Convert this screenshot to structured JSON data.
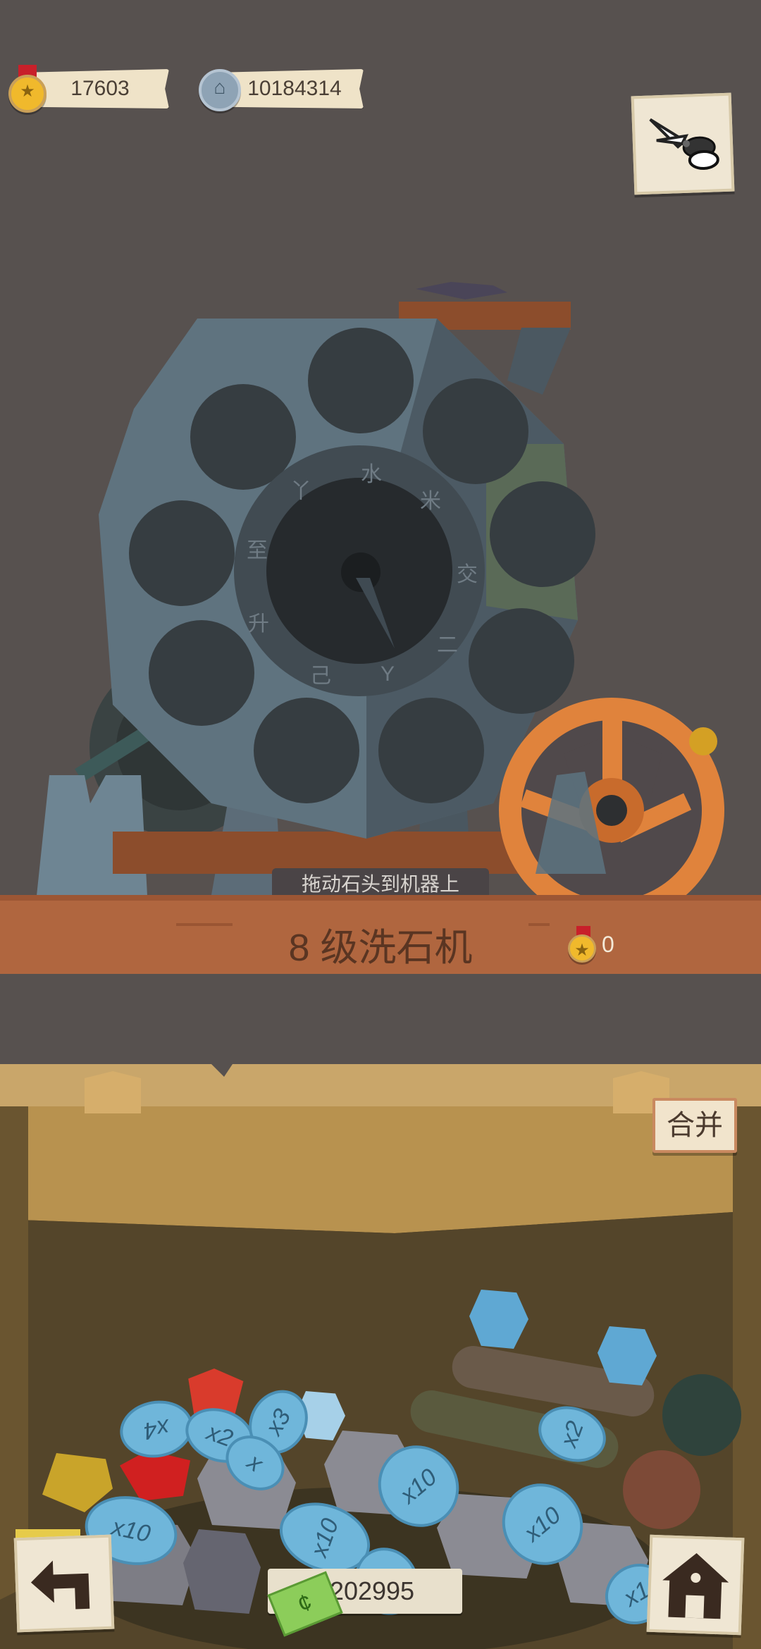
{
  "currency": {
    "medals": "17603",
    "gears": "10184314"
  },
  "machine": {
    "hint": "拖动石头到机器上",
    "level_label": "8 级洗石机",
    "reward_count": "0"
  },
  "bin": {
    "merge_label": "合并",
    "money": "5202995"
  },
  "stones": {
    "t1": "x4",
    "t2": "x2",
    "t3": "x3",
    "t4": "x",
    "t5": "x10",
    "t6": "x10",
    "t7": "x10",
    "t8": "x10",
    "t9": "x2",
    "t10": "x1",
    "t11": "x1",
    "t12": "x10"
  },
  "dial_marks": [
    "水",
    "米",
    "交",
    "二",
    "Y",
    "己",
    "升",
    "至",
    "丫"
  ],
  "colors": {
    "background": "#57514f",
    "wood": "#b0663f",
    "wheel": "#e0833c",
    "tag": "#6fb6da"
  },
  "icons": {
    "medal": "medal-icon",
    "gear": "gear-coin-icon",
    "tool": "pliers-icon",
    "back": "back-arrow-icon",
    "home": "home-icon",
    "money": "banknote-icon"
  }
}
